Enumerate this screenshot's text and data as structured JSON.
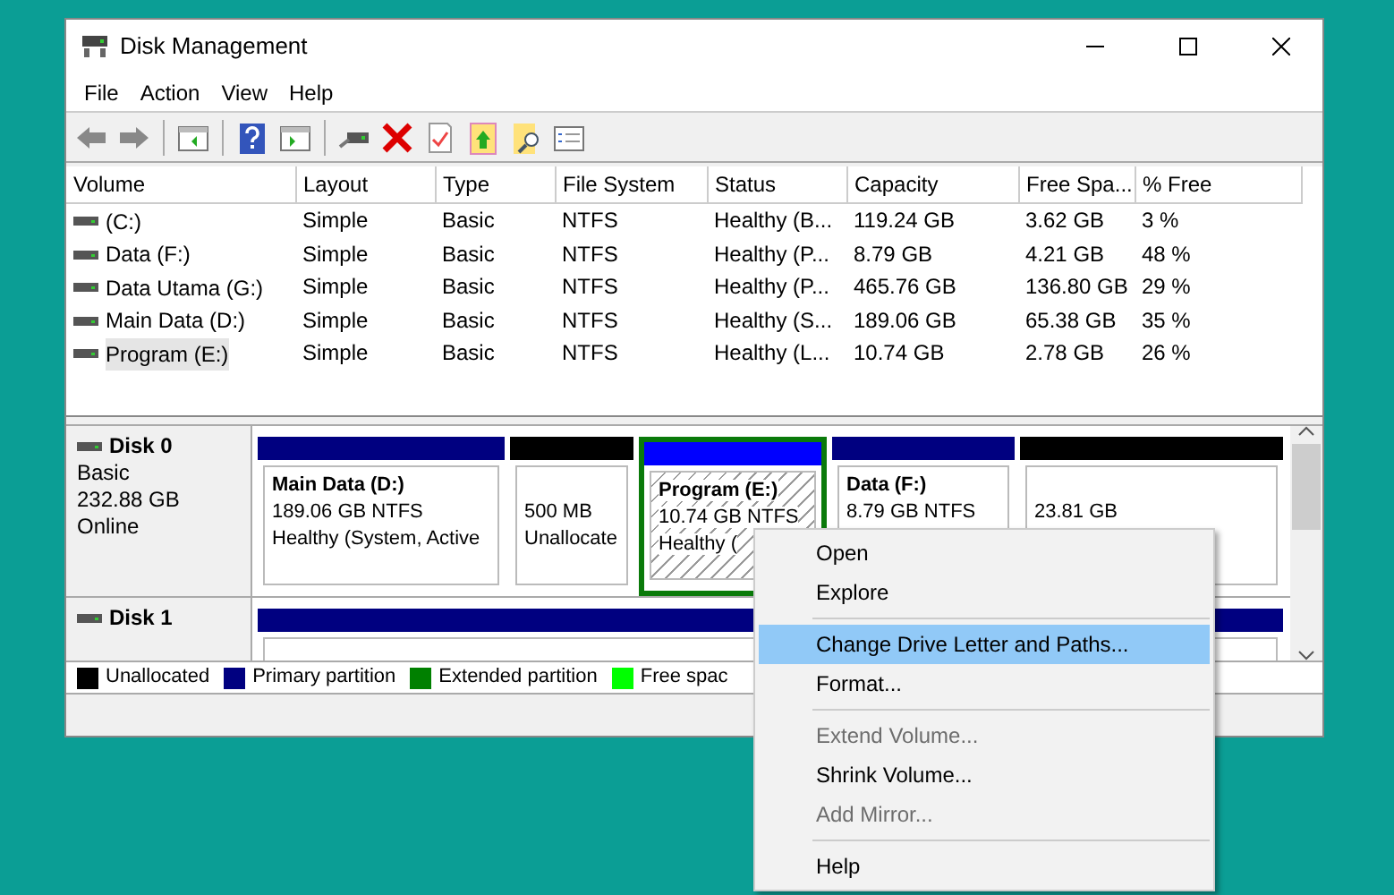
{
  "window": {
    "title": "Disk Management"
  },
  "menu": [
    "File",
    "Action",
    "View",
    "Help"
  ],
  "table": {
    "columns": [
      "Volume",
      "Layout",
      "Type",
      "File System",
      "Status",
      "Capacity",
      "Free Spa...",
      "% Free"
    ],
    "rows": [
      {
        "cells": [
          " (C:)",
          "Simple",
          "Basic",
          "NTFS",
          "Healthy (B...",
          "119.24 GB",
          "3.62 GB",
          "3 %"
        ],
        "selected": false
      },
      {
        "cells": [
          "Data (F:)",
          "Simple",
          "Basic",
          "NTFS",
          "Healthy (P...",
          "8.79 GB",
          "4.21 GB",
          "48 %"
        ],
        "selected": false
      },
      {
        "cells": [
          "Data Utama (G:)",
          "Simple",
          "Basic",
          "NTFS",
          "Healthy (P...",
          "465.76 GB",
          "136.80 GB",
          "29 %"
        ],
        "selected": false
      },
      {
        "cells": [
          "Main Data (D:)",
          "Simple",
          "Basic",
          "NTFS",
          "Healthy (S...",
          "189.06 GB",
          "65.38 GB",
          "35 %"
        ],
        "selected": false
      },
      {
        "cells": [
          "Program (E:)",
          "Simple",
          "Basic",
          "NTFS",
          "Healthy (L...",
          "10.74 GB",
          "2.78 GB",
          "26 %"
        ],
        "selected": true
      }
    ]
  },
  "disks": [
    {
      "name": "Disk 0",
      "info": [
        "Basic",
        "232.88 GB",
        "Online"
      ],
      "partitions": [
        {
          "kind": "primary",
          "lines": [
            "Main Data  (D:)",
            "189.06 GB NTFS",
            "Healthy (System, Active"
          ],
          "selected": false
        },
        {
          "kind": "unallocated",
          "lines": [
            "500 MB",
            "Unallocate"
          ],
          "selected": false
        },
        {
          "kind": "logical",
          "lines": [
            "Program  (E:)",
            "10.74 GB NTFS",
            "Healthy ("
          ],
          "selected": true
        },
        {
          "kind": "primary",
          "lines": [
            "Data  (F:)",
            "8.79 GB NTFS"
          ],
          "selected": false
        },
        {
          "kind": "unallocated",
          "lines": [
            "23.81 GB"
          ],
          "selected": false
        }
      ]
    },
    {
      "name": "Disk 1",
      "partitions": [
        {
          "kind": "primary",
          "selected": false
        }
      ]
    }
  ],
  "legend": [
    {
      "label": "Unallocated",
      "color": "#000000"
    },
    {
      "label": "Primary partition",
      "color": "#000080"
    },
    {
      "label": "Extended partition",
      "color": "#008000"
    },
    {
      "label": "Free spac",
      "color": "#00ff00"
    }
  ],
  "context_menu": [
    {
      "kind": "item",
      "label": "Open",
      "disabled": false,
      "selected": false
    },
    {
      "kind": "item",
      "label": "Explore",
      "disabled": false,
      "selected": false
    },
    {
      "kind": "separator"
    },
    {
      "kind": "item",
      "label": "Change Drive Letter and Paths...",
      "disabled": false,
      "selected": true
    },
    {
      "kind": "item",
      "label": "Format...",
      "disabled": false,
      "selected": false
    },
    {
      "kind": "separator"
    },
    {
      "kind": "item",
      "label": "Extend Volume...",
      "disabled": true,
      "selected": false
    },
    {
      "kind": "item",
      "label": "Shrink Volume...",
      "disabled": false,
      "selected": false
    },
    {
      "kind": "item",
      "label": "Add Mirror...",
      "disabled": true,
      "selected": false
    },
    {
      "kind": "separator"
    },
    {
      "kind": "item",
      "label": "Help",
      "disabled": false,
      "selected": false
    }
  ]
}
